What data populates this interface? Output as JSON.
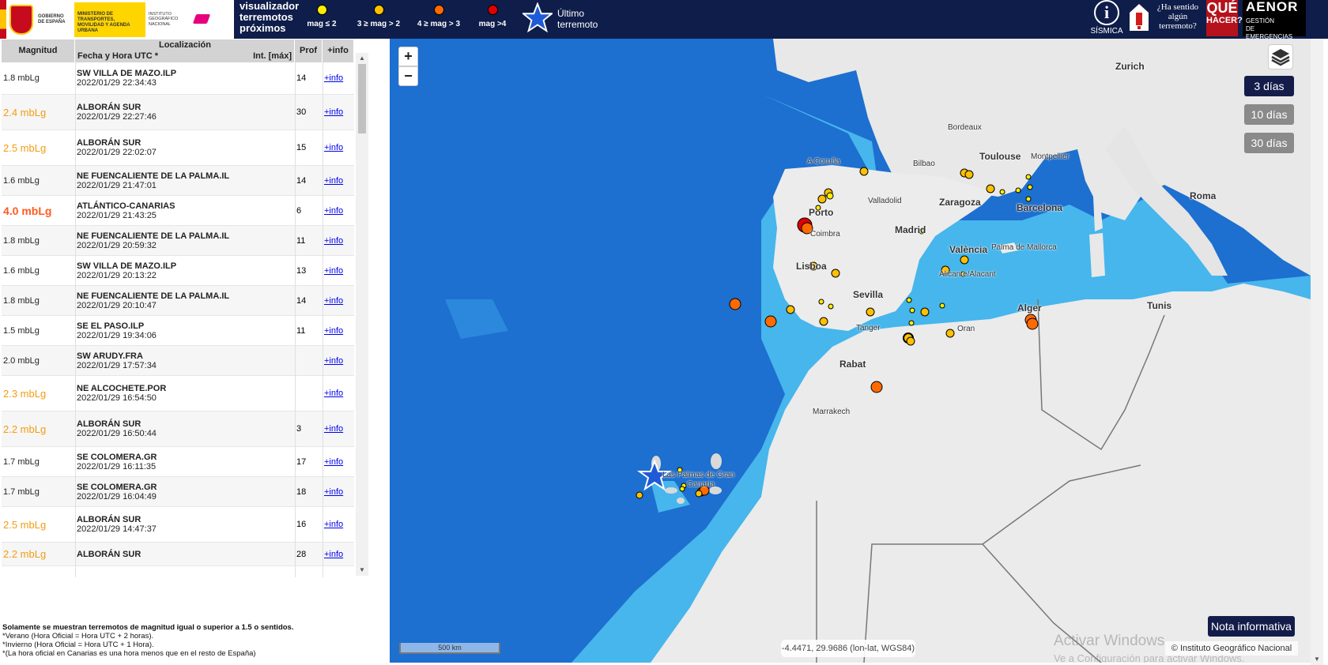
{
  "header": {
    "gov_text": "GOBIERNO DE ESPAÑA",
    "ministry_text": "MINISTERIO DE TRANSPORTES, MOVILIDAD Y AGENDA URBANA",
    "institute_text": "INSTITUTO GEOGRÁFICO NACIONAL",
    "app_title": "visualizador\nterremotos\npróximos",
    "legend": [
      {
        "label": "mag ≤ 2",
        "color": "#ffee00"
      },
      {
        "label": "3 ≥ mag > 2",
        "color": "#ffc000"
      },
      {
        "label": "4 ≥ mag > 3",
        "color": "#ff6a00"
      },
      {
        "label": "mag >4",
        "color": "#e00000"
      }
    ],
    "last_quake_label": "Último\nterremoto",
    "sismica_label": "SÍSMICA",
    "felt_text": "¿Ha sentido\nalgún\nterremoto?",
    "que_hacer_1": "QUÉ",
    "que_hacer_2": "HACER?",
    "aenor_title": "AENOR",
    "aenor_sub": "GESTIÓN\nDE EMERGENCIAS"
  },
  "table": {
    "headers": {
      "magnitude": "Magnitud",
      "location": "Localización",
      "datetime": "Fecha y Hora UTC *",
      "intensity": "Int. [máx]",
      "depth": "Prof",
      "info": "+info"
    },
    "rows": [
      {
        "mag": "1.8 mbLg",
        "color": "#222222",
        "place": "SW VILLA DE MAZO.ILP",
        "date": "2022/01/29 22:34:43",
        "depth": "14",
        "info": "+info"
      },
      {
        "mag": "2.4 mbLg",
        "color": "#f39c12",
        "place": "ALBORÁN SUR",
        "date": "2022/01/29 22:27:46",
        "depth": "30",
        "info": "+info"
      },
      {
        "mag": "2.5 mbLg",
        "color": "#f39c12",
        "place": "ALBORÁN SUR",
        "date": "2022/01/29 22:02:07",
        "depth": "15",
        "info": "+info"
      },
      {
        "mag": "1.6 mbLg",
        "color": "#222222",
        "place": "NE FUENCALIENTE DE LA PALMA.IL",
        "date": "2022/01/29 21:47:01",
        "depth": "14",
        "info": "+info"
      },
      {
        "mag": "4.0 mbLg",
        "color": "#ff5a1f",
        "place": "ATLÁNTICO-CANARIAS",
        "date": "2022/01/29 21:43:25",
        "depth": "6",
        "info": "+info"
      },
      {
        "mag": "1.8 mbLg",
        "color": "#222222",
        "place": "NE FUENCALIENTE DE LA PALMA.IL",
        "date": "2022/01/29 20:59:32",
        "depth": "11",
        "info": "+info"
      },
      {
        "mag": "1.6 mbLg",
        "color": "#222222",
        "place": "SW VILLA DE MAZO.ILP",
        "date": "2022/01/29 20:13:22",
        "depth": "13",
        "info": "+info"
      },
      {
        "mag": "1.8 mbLg",
        "color": "#222222",
        "place": "NE FUENCALIENTE DE LA PALMA.IL",
        "date": "2022/01/29 20:10:47",
        "depth": "14",
        "info": "+info"
      },
      {
        "mag": "1.5 mbLg",
        "color": "#222222",
        "place": "SE EL PASO.ILP",
        "date": "2022/01/29 19:34:06",
        "depth": "11",
        "info": "+info"
      },
      {
        "mag": "2.0 mbLg",
        "color": "#222222",
        "place": "SW ARUDY.FRA",
        "date": "2022/01/29 17:57:34",
        "depth": "",
        "info": "+info"
      },
      {
        "mag": "2.3 mbLg",
        "color": "#f39c12",
        "place": "NE ALCOCHETE.POR",
        "date": "2022/01/29 16:54:50",
        "depth": "",
        "info": "+info"
      },
      {
        "mag": "2.2 mbLg",
        "color": "#f39c12",
        "place": "ALBORÁN SUR",
        "date": "2022/01/29 16:50:44",
        "depth": "3",
        "info": "+info"
      },
      {
        "mag": "1.7 mbLg",
        "color": "#222222",
        "place": "SE COLOMERA.GR",
        "date": "2022/01/29 16:11:35",
        "depth": "17",
        "info": "+info"
      },
      {
        "mag": "1.7 mbLg",
        "color": "#222222",
        "place": "SE COLOMERA.GR",
        "date": "2022/01/29 16:04:49",
        "depth": "18",
        "info": "+info"
      },
      {
        "mag": "2.5 mbLg",
        "color": "#f39c12",
        "place": "ALBORÁN SUR",
        "date": "2022/01/29 14:47:37",
        "depth": "16",
        "info": "+info"
      },
      {
        "mag": "2.2 mbLg",
        "color": "#f39c12",
        "place": "ALBORÁN SUR",
        "date": "",
        "depth": "28",
        "info": "+info"
      }
    ]
  },
  "notes": {
    "n1": "Solamente se muestran terremotos de magnitud igual o superior a 1.5 o sentidos.",
    "n2": "*Verano (Hora Oficial = Hora UTC + 2 horas).",
    "n3": "*Invierno (Hora Oficial = Hora UTC + 1 Hora).",
    "n4": "*(La hora oficial en Canarias es una hora menos que en el resto de España)"
  },
  "map": {
    "zoom_in": "+",
    "zoom_out": "−",
    "days": [
      "3 días",
      "10 días",
      "30 días"
    ],
    "selected_days": "3 días",
    "labels": {
      "zurich": "Zurich",
      "bordeaux": "Bordeaux",
      "a_coruna": "A Coruña",
      "bilbao": "Bilbao",
      "toulouse": "Toulouse",
      "montpellier": "Montpellier",
      "valladolid": "Valladolid",
      "zaragoza": "Zaragoza",
      "barcelona": "Barcelona",
      "roma": "Roma",
      "porto": "Porto",
      "coimbra": "Coimbra",
      "madrid": "Madrid",
      "valencia": "València",
      "palma": "Palma de Mallorca",
      "lisboa": "Lisboa",
      "alicante": "Alicante/Alacant",
      "sevilla": "Sevilla",
      "alger": "Alger",
      "tunis": "Tunis",
      "tanger": "Tanger",
      "oran": "Oran",
      "rabat": "Rabat",
      "marrakech": "Marrakech",
      "las_palmas_1": "Las Palmas de Gran",
      "las_palmas_2": "Canaria"
    },
    "nota_informativa": "Nota informativa",
    "coords": "-4.4471, 29.9686 (lon-lat, WGS84)",
    "scale": "500 km",
    "attribution": "© Instituto Geográfico Nacional",
    "watermark_1": "Activar Windows",
    "watermark_2": "Ve a Configuración para activar Windows."
  }
}
